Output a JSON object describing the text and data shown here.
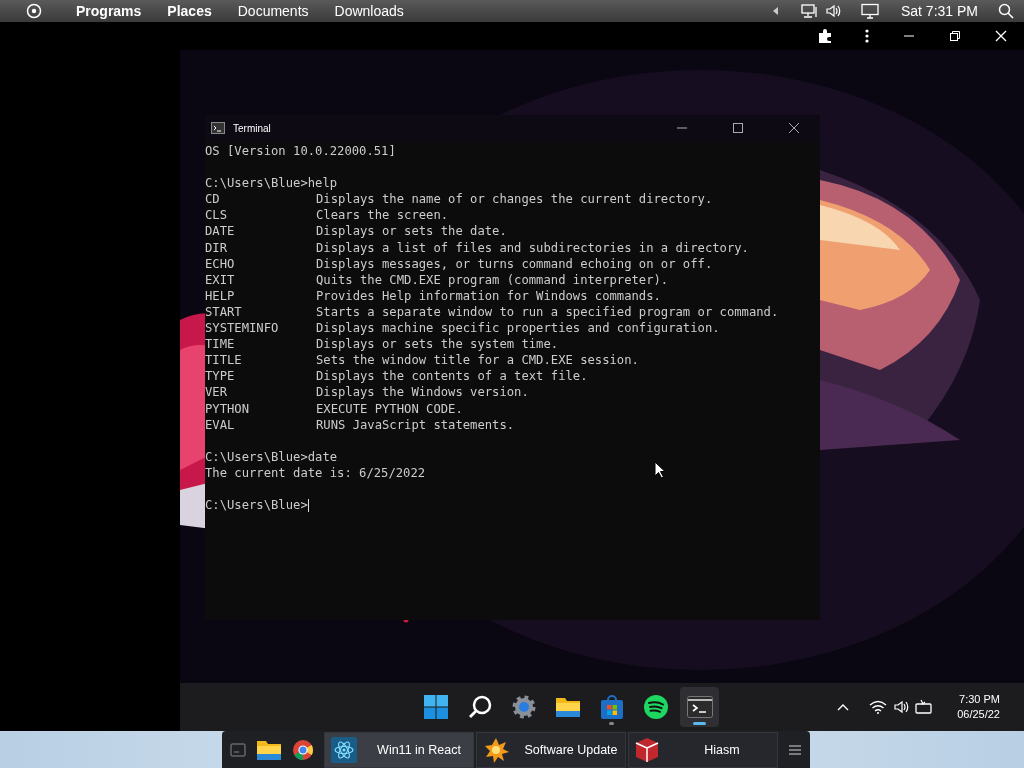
{
  "top_bar": {
    "menu": [
      {
        "label": "Programs",
        "kind": "menu"
      },
      {
        "label": "Places",
        "kind": "menu"
      },
      {
        "label": "Documents",
        "kind": "bookmark"
      },
      {
        "label": "Downloads",
        "kind": "bookmark"
      }
    ],
    "clock": "Sat 7:31 PM"
  },
  "terminal": {
    "title": "Terminal",
    "lines": [
      {
        "kind": "text",
        "text": "OS [Version 10.0.22000.51]"
      },
      {
        "kind": "blank"
      },
      {
        "kind": "text",
        "text": "C:\\Users\\Blue>help"
      },
      {
        "kind": "help",
        "name": "CD",
        "description": "Displays the name of or changes the current directory."
      },
      {
        "kind": "help",
        "name": "CLS",
        "description": "Clears the screen."
      },
      {
        "kind": "help",
        "name": "DATE",
        "description": "Displays or sets the date."
      },
      {
        "kind": "help",
        "name": "DIR",
        "description": "Displays a list of files and subdirectories in a directory."
      },
      {
        "kind": "help",
        "name": "ECHO",
        "description": "Displays messages, or turns command echoing on or off."
      },
      {
        "kind": "help",
        "name": "EXIT",
        "description": "Quits the CMD.EXE program (command interpreter)."
      },
      {
        "kind": "help",
        "name": "HELP",
        "description": "Provides Help information for Windows commands."
      },
      {
        "kind": "help",
        "name": "START",
        "description": "Starts a separate window to run a specified program or command."
      },
      {
        "kind": "help",
        "name": "SYSTEMINFO",
        "description": "Displays machine specific properties and configuration."
      },
      {
        "kind": "help",
        "name": "TIME",
        "description": "Displays or sets the system time."
      },
      {
        "kind": "help",
        "name": "TITLE",
        "description": "Sets the window title for a CMD.EXE session."
      },
      {
        "kind": "help",
        "name": "TYPE",
        "description": "Displays the contents of a text file."
      },
      {
        "kind": "help",
        "name": "VER",
        "description": "Displays the Windows version."
      },
      {
        "kind": "help",
        "name": "PYTHON",
        "description": "EXECUTE PYTHON CODE."
      },
      {
        "kind": "help",
        "name": "EVAL",
        "description": "RUNS JavaScript statements."
      },
      {
        "kind": "blank"
      },
      {
        "kind": "text",
        "text": "C:\\Users\\Blue>date"
      },
      {
        "kind": "text",
        "text": "The current date is: 6/25/2022"
      },
      {
        "kind": "blank"
      },
      {
        "kind": "prompt",
        "text": "C:\\Users\\Blue>"
      }
    ]
  },
  "taskbar": {
    "apps": [
      {
        "kind": "start",
        "running": false,
        "selected": false
      },
      {
        "kind": "search",
        "running": false,
        "selected": false
      },
      {
        "kind": "settings",
        "running": false,
        "selected": false
      },
      {
        "kind": "folder",
        "running": false,
        "selected": false
      },
      {
        "kind": "store",
        "running": true,
        "selected": false
      },
      {
        "kind": "music",
        "running": false,
        "selected": false
      },
      {
        "kind": "terminal",
        "running": true,
        "selected": true
      }
    ],
    "time": "7:30 PM",
    "date": "06/25/22"
  },
  "panel": {
    "launchers": [
      {
        "kind": "desktop"
      },
      {
        "kind": "folder"
      },
      {
        "kind": "browser"
      }
    ],
    "tasks": [
      {
        "label": "Win11 in React",
        "kind": "react",
        "selected": true
      },
      {
        "label": "Software Update",
        "kind": "update",
        "selected": false
      },
      {
        "label": "Hiasm",
        "kind": "hiasm",
        "selected": false
      }
    ]
  }
}
